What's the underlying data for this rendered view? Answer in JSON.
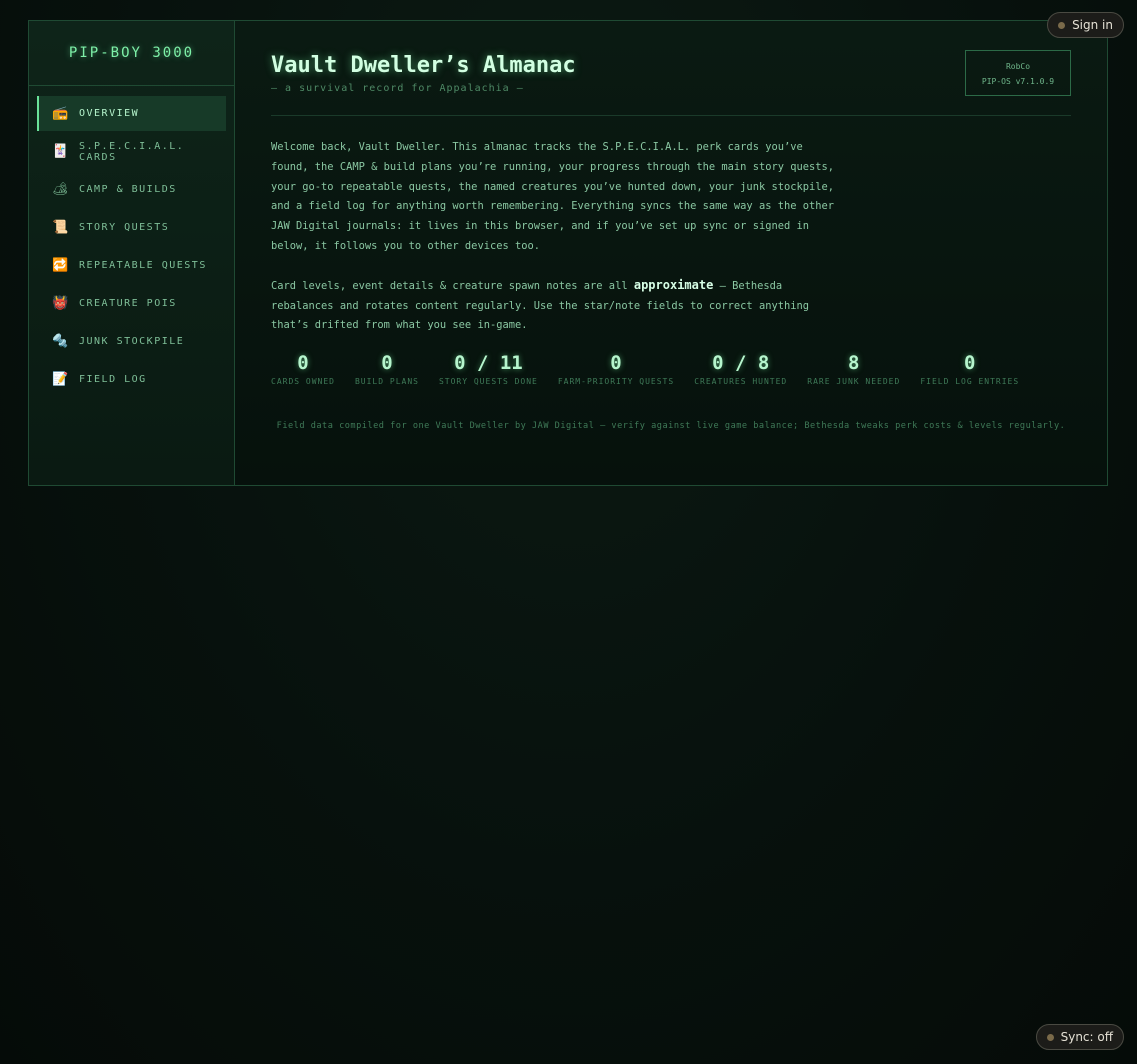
{
  "brand": "PIP-BOY 3000",
  "nav": [
    {
      "icon": "radio-icon",
      "label": "OVERVIEW"
    },
    {
      "icon": "card-icon",
      "label": "S.P.E.C.I.A.L. CARDS"
    },
    {
      "icon": "tent-icon",
      "label": "CAMP & BUILDS"
    },
    {
      "icon": "scroll-icon",
      "label": "STORY QUESTS"
    },
    {
      "icon": "repeat-icon",
      "label": "REPEATABLE QUESTS"
    },
    {
      "icon": "creature-icon",
      "label": "CREATURE POIS"
    },
    {
      "icon": "nut-bolt-icon",
      "label": "JUNK STOCKPILE"
    },
    {
      "icon": "memo-icon",
      "label": "FIELD LOG"
    }
  ],
  "header": {
    "title": "Vault Dweller’s Almanac",
    "subtitle": "— a survival record for Appalachia —",
    "robco_line1": "RobCo",
    "robco_line2": "PIP-OS v7.1.0.9"
  },
  "intro": {
    "p1": "Welcome back, Vault Dweller. This almanac tracks the S.P.E.C.I.A.L. perk cards you’ve found, the CAMP & build plans you’re running, your progress through the main story quests, your go-to repeatable quests, the named creatures you’ve hunted down, your junk stockpile, and a field log for anything worth remembering. Everything syncs the same way as the other JAW Digital journals: it lives in this browser, and if you’ve set up sync or signed in below, it follows you to other devices too.",
    "p2_before": "Card levels, event details & creature spawn notes are all ",
    "p2_emph": "approximate",
    "p2_after": " — Bethesda rebalances and rotates content regularly. Use the star/note fields to correct anything that’s drifted from what you see in-game."
  },
  "stats": [
    {
      "value": "0",
      "label": "CARDS OWNED"
    },
    {
      "value": "0",
      "label": "BUILD PLANS"
    },
    {
      "value": "0 / 11",
      "label": "STORY QUESTS DONE"
    },
    {
      "value": "0",
      "label": "FARM-PRIORITY QUESTS"
    },
    {
      "value": "0 / 8",
      "label": "CREATURES HUNTED"
    },
    {
      "value": "8",
      "label": "RARE JUNK NEEDED"
    },
    {
      "value": "0",
      "label": "FIELD LOG ENTRIES"
    }
  ],
  "footnote": "Field data compiled for one Vault Dweller by JAW Digital — verify against live game balance; Bethesda tweaks perk costs & levels regularly.",
  "signin_label": "Sign in",
  "sync_label": "Sync: off"
}
